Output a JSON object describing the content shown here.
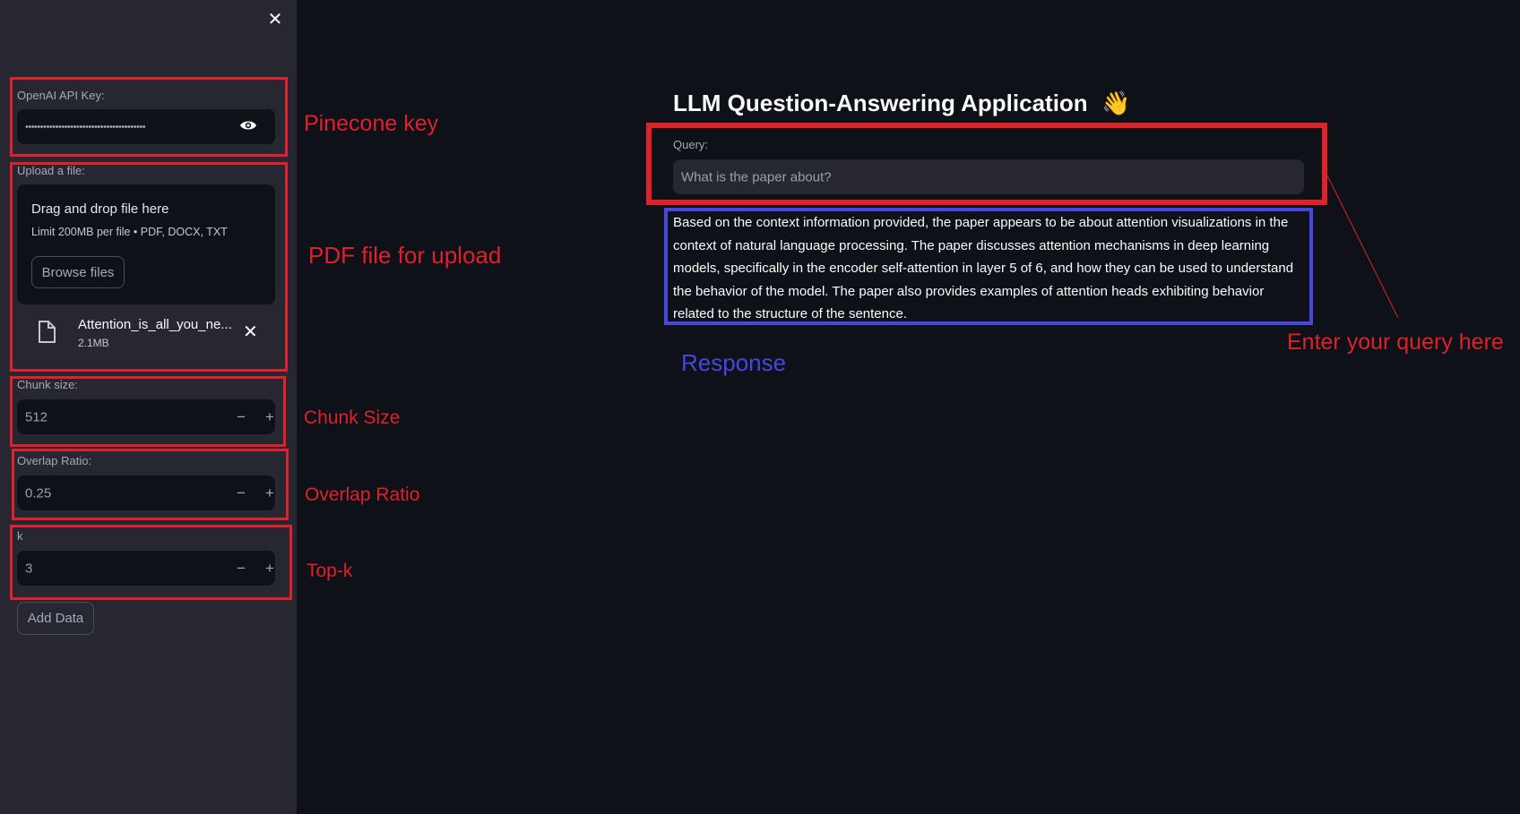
{
  "sidebar": {
    "close_icon": "close-icon",
    "api_key": {
      "label": "OpenAI API Key:",
      "value": "••••••••••••••••••••••••••••••••••••••••"
    },
    "upload": {
      "label": "Upload a file:",
      "drop_title": "Drag and drop file here",
      "limit": "Limit 200MB per file • PDF, DOCX, TXT",
      "browse_label": "Browse files",
      "file_name": "Attention_is_all_you_ne...",
      "file_size": "2.1MB"
    },
    "chunk_size": {
      "label": "Chunk size:",
      "value": "512"
    },
    "overlap": {
      "label": "Overlap Ratio:",
      "value": "0.25"
    },
    "k": {
      "label": "k",
      "value": "3"
    },
    "add_data_label": "Add Data"
  },
  "stepper": {
    "minus": "−",
    "plus": "+"
  },
  "main": {
    "title": "LLM Question-Answering Application",
    "title_emoji": "👋",
    "query_label": "Query:",
    "query_placeholder": "What is the paper about?",
    "response": "Based on the context information provided, the paper appears to be about attention visualizations in the context of natural language processing. The paper discusses attention mechanisms in deep learning models, specifically in the encoder self-attention in layer 5 of 6, and how they can be used to understand the behavior of the model. The paper also provides examples of attention heads exhibiting behavior related to the structure of the sentence."
  },
  "annotations": {
    "pinecone": "Pinecone key",
    "pdf": "PDF file for upload",
    "chunk": "Chunk Size",
    "overlap": "Overlap Ratio",
    "topk": "Top-k",
    "query": "Enter your query here",
    "response": "Response",
    "red_color": "#e0202a",
    "blue_color": "#4747e0"
  }
}
